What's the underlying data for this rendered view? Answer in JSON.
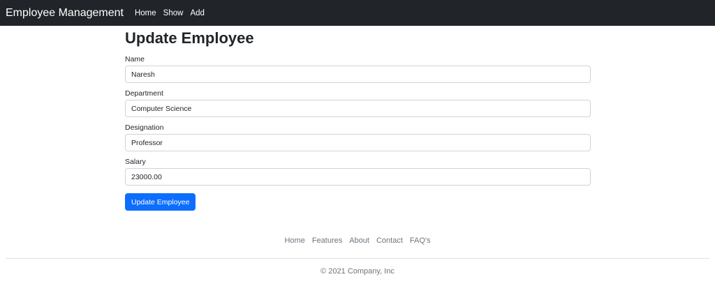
{
  "navbar": {
    "brand": "Employee Management",
    "links": [
      "Home",
      "Show",
      "Add"
    ]
  },
  "page": {
    "title": "Update Employee"
  },
  "form": {
    "fields": [
      {
        "label": "Name",
        "value": "Naresh"
      },
      {
        "label": "Department",
        "value": "Computer Science"
      },
      {
        "label": "Designation",
        "value": "Professor"
      },
      {
        "label": "Salary",
        "value": "23000.00"
      }
    ],
    "submit_label": "Update Employee"
  },
  "footer": {
    "links": [
      "Home",
      "Features",
      "About",
      "Contact",
      "FAQ's"
    ],
    "copyright": "© 2021 Company, Inc"
  },
  "colors": {
    "navbar_bg": "#212529",
    "primary": "#0d6efd",
    "muted": "#6c757d"
  }
}
